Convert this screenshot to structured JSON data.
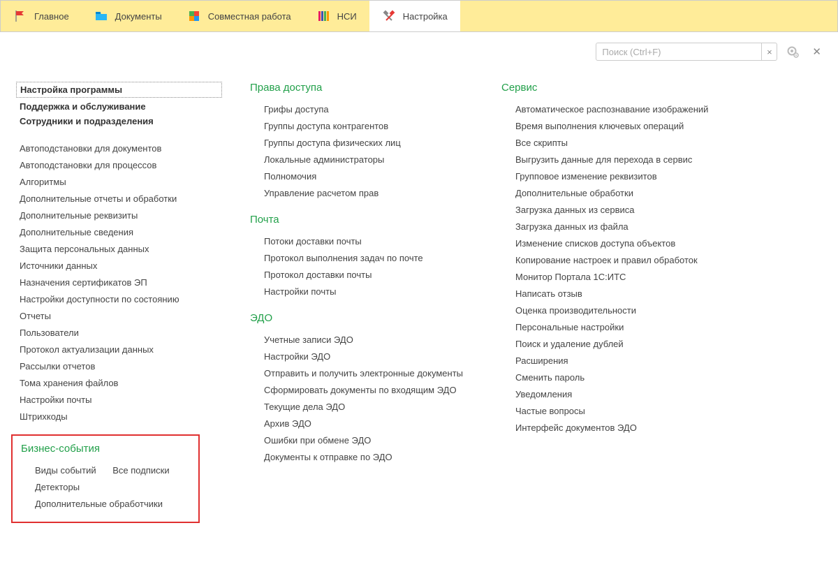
{
  "tabs": {
    "main": "Главное",
    "documents": "Документы",
    "collab": "Совместная работа",
    "nsi": "НСИ",
    "settings": "Настройка"
  },
  "search": {
    "placeholder": "Поиск (Ctrl+F)"
  },
  "col1": {
    "bold1": "Настройка программы",
    "bold2": "Поддержка и обслуживание",
    "bold3": "Сотрудники и подразделения",
    "links": {
      "l0": "Автоподстановки для документов",
      "l1": "Автоподстановки для процессов",
      "l2": "Алгоритмы",
      "l3": "Дополнительные отчеты и обработки",
      "l4": "Дополнительные реквизиты",
      "l5": "Дополнительные сведения",
      "l6": "Защита персональных данных",
      "l7": "Источники данных",
      "l8": "Назначения сертификатов ЭП",
      "l9": "Настройки доступности по состоянию",
      "l10": "Отчеты",
      "l11": "Пользователи",
      "l12": "Протокол актуализации данных",
      "l13": "Рассылки отчетов",
      "l14": "Тома хранения файлов",
      "l15": "Настройки почты",
      "l16": "Штрихкоды"
    },
    "events_head": "Бизнес-события",
    "events": {
      "e0": "Виды событий",
      "e1": "Все подписки",
      "e2": "Детекторы",
      "e3": "Дополнительные обработчики"
    }
  },
  "col2": {
    "access_head": "Права доступа",
    "access": {
      "a0": "Грифы доступа",
      "a1": "Группы доступа контрагентов",
      "a2": "Группы доступа физических лиц",
      "a3": "Локальные администраторы",
      "a4": "Полномочия",
      "a5": "Управление расчетом прав"
    },
    "mail_head": "Почта",
    "mail": {
      "m0": "Потоки доставки почты",
      "m1": "Протокол выполнения задач по почте",
      "m2": "Протокол доставки почты",
      "m3": "Настройки почты"
    },
    "edo_head": "ЭДО",
    "edo": {
      "d0": "Учетные записи ЭДО",
      "d1": "Настройки ЭДО",
      "d2": "Отправить и получить электронные документы",
      "d3": "Сформировать документы по входящим ЭДО",
      "d4": "Текущие дела ЭДО",
      "d5": "Архив ЭДО",
      "d6": "Ошибки при обмене ЭДО",
      "d7": "Документы к отправке по ЭДО"
    }
  },
  "col3": {
    "service_head": "Сервис",
    "service": {
      "s0": "Автоматическое распознавание изображений",
      "s1": "Время выполнения ключевых операций",
      "s2": "Все скрипты",
      "s3": "Выгрузить данные для перехода в сервис",
      "s4": "Групповое изменение реквизитов",
      "s5": "Дополнительные обработки",
      "s6": "Загрузка данных из сервиса",
      "s7": "Загрузка данных из файла",
      "s8": "Изменение списков доступа объектов",
      "s9": "Копирование настроек и правил обработок",
      "s10": "Монитор Портала 1С:ИТС",
      "s11": "Написать отзыв",
      "s12": "Оценка производительности",
      "s13": "Персональные настройки",
      "s14": "Поиск и удаление дублей",
      "s15": "Расширения",
      "s16": "Сменить пароль",
      "s17": "Уведомления",
      "s18": "Частые вопросы",
      "s19": "Интерфейс документов ЭДО"
    }
  }
}
